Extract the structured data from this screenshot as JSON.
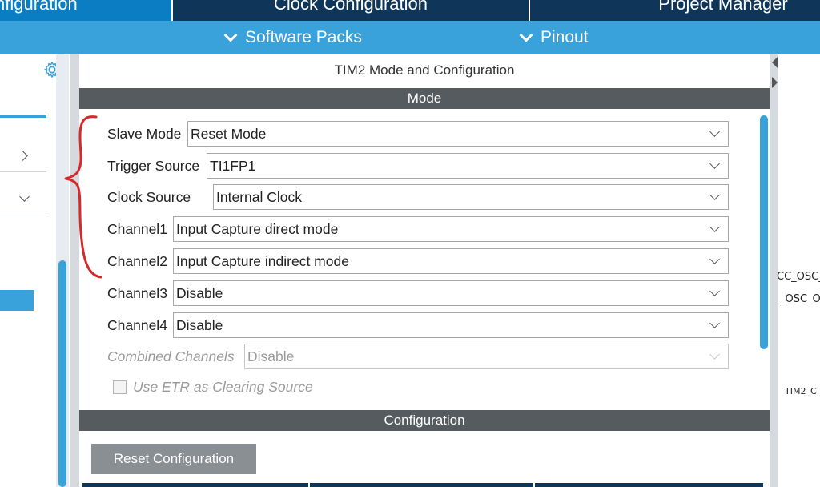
{
  "top_tabs": {
    "pinout_config": "nfiguration",
    "clock_config": "Clock Configuration",
    "project_manager": "Project Manager"
  },
  "subbar": {
    "software_packs": "Software Packs",
    "pinout": "Pinout"
  },
  "panel": {
    "title": "TIM2 Mode and Configuration",
    "mode_header": "Mode",
    "configuration_header": "Configuration",
    "reset_button": "Reset Configuration"
  },
  "mode": {
    "slave_mode": {
      "label": "Slave Mode",
      "value": "Reset Mode"
    },
    "trigger_source": {
      "label": "Trigger Source",
      "value": "TI1FP1"
    },
    "clock_source": {
      "label": "Clock Source",
      "value": "Internal Clock"
    },
    "channel1": {
      "label": "Channel1",
      "value": "Input Capture direct mode"
    },
    "channel2": {
      "label": "Channel2",
      "value": "Input Capture indirect mode"
    },
    "channel3": {
      "label": "Channel3",
      "value": "Disable"
    },
    "channel4": {
      "label": "Channel4",
      "value": "Disable"
    },
    "combined_channels": {
      "label": "Combined Channels",
      "value": "Disable"
    },
    "use_etr": {
      "label": "Use ETR as Clearing Source",
      "checked": false
    }
  },
  "pinout_labels": {
    "osc_in": "CC_OSC_",
    "osc_out": "_OSC_O",
    "tim2": "TIM2_C"
  },
  "colors": {
    "dark_navy": "#0f3558",
    "accent_blue": "#3aa2da",
    "section_bar": "#565b60",
    "annotation_red": "#d42a2a"
  }
}
